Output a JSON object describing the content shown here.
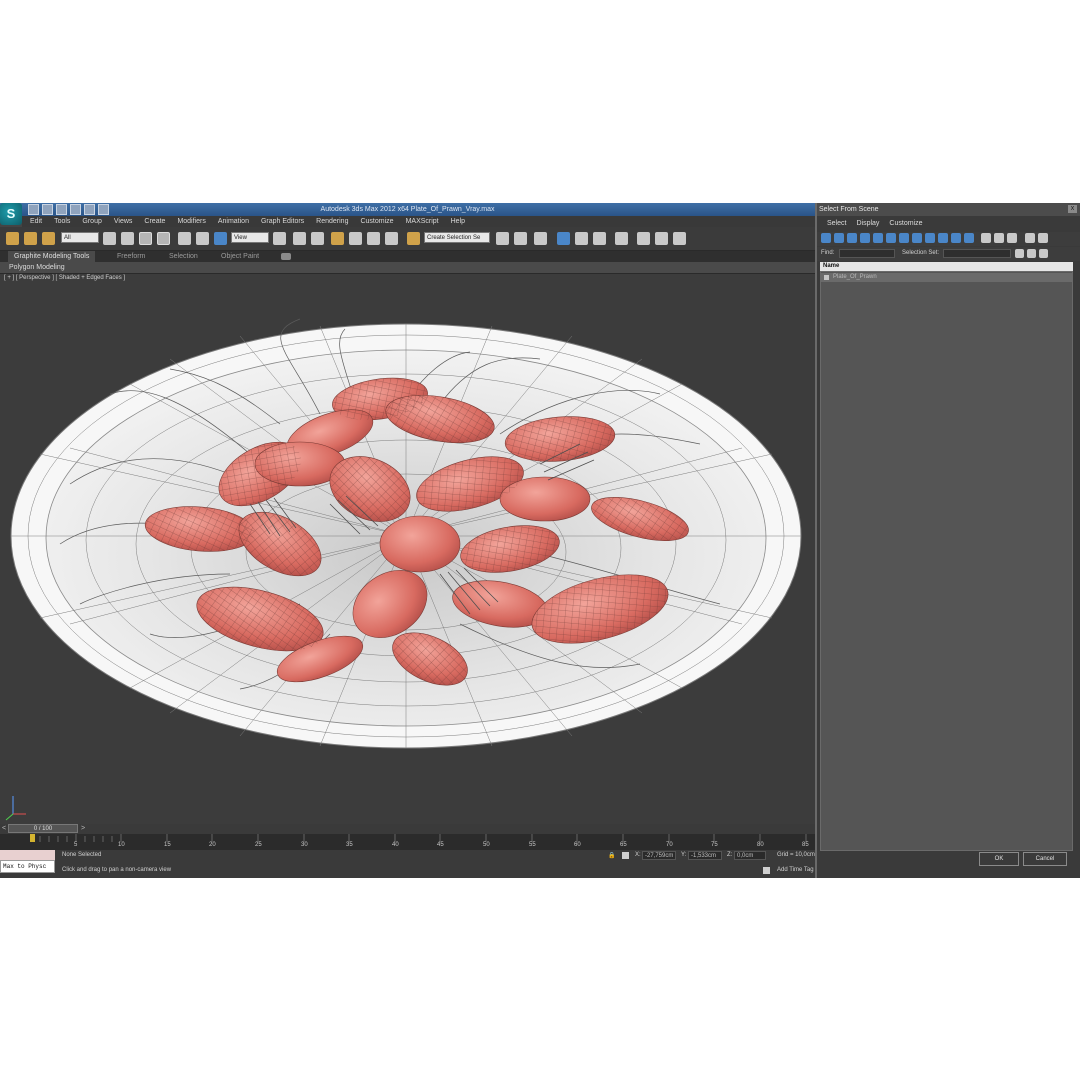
{
  "window": {
    "title": "Autodesk 3ds Max  2012 x64      Plate_Of_Prawn_Vray.max",
    "logo": "S"
  },
  "menubar": {
    "items": [
      "Edit",
      "Tools",
      "Group",
      "Views",
      "Create",
      "Modifiers",
      "Animation",
      "Graph Editors",
      "Rendering",
      "Customize",
      "MAXScript",
      "Help"
    ]
  },
  "toolbar": {
    "selection_filter": "All",
    "reference_coord": "View",
    "named_selection": "Create Selection Se"
  },
  "ribbon": {
    "tabs": [
      "Graphite Modeling Tools",
      "Freeform",
      "Selection",
      "Object Paint"
    ],
    "active_tab": "Graphite Modeling Tools",
    "panel": "Polygon Modeling"
  },
  "viewport": {
    "label": "[ + ] [ Perspective ] [ Shaded + Edged Faces ]",
    "scene": "wireframe-plate-of-prawns"
  },
  "timeline": {
    "slider_label": "0 / 100",
    "ticks": [
      "5",
      "10",
      "15",
      "20",
      "25",
      "30",
      "35",
      "40",
      "45",
      "50",
      "55",
      "60",
      "65",
      "70",
      "75",
      "80",
      "85"
    ]
  },
  "status": {
    "selection": "None Selected",
    "prompt": "Click and drag to pan a non-camera view",
    "maxscript": "Max to Physc",
    "x_label": "X:",
    "x_value": "-27,759cm",
    "y_label": "Y:",
    "y_value": "-1,533cm",
    "z_label": "Z:",
    "z_value": "0,0cm",
    "grid": "Grid = 10,0cm",
    "add_time_tag": "Add Time Tag"
  },
  "select_dialog": {
    "title": "Select From Scene",
    "close": "x",
    "menu": [
      "Select",
      "Display",
      "Customize"
    ],
    "find_label": "Find:",
    "selection_set_label": "Selection Set:",
    "column_name": "Name",
    "items": [
      "Plate_Of_Prawn"
    ],
    "ok": "OK",
    "cancel": "Cancel"
  }
}
